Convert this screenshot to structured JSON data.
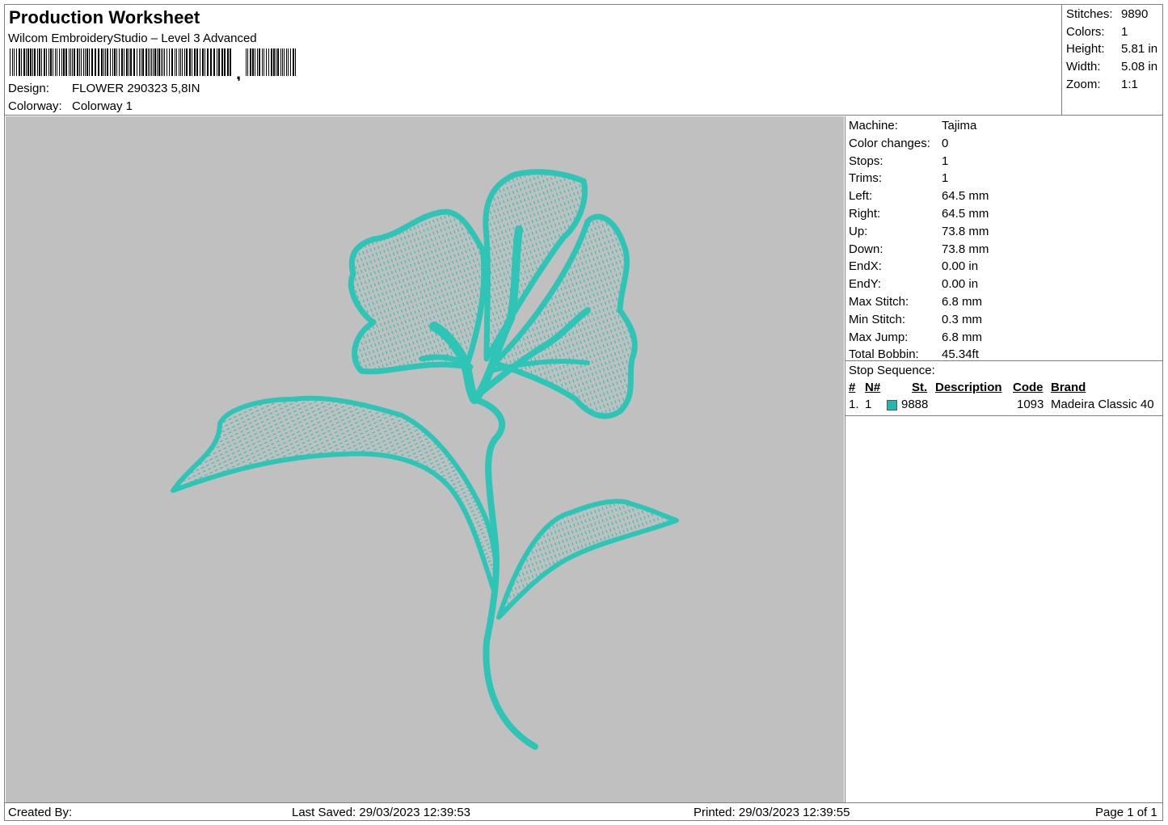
{
  "header": {
    "title": "Production Worksheet",
    "subtitle": "Wilcom EmbroideryStudio – Level 3 Advanced",
    "barcode_label": "barcode",
    "design_label": "Design:",
    "design_value": "FLOWER 290323 5,8IN",
    "colorway_label": "Colorway:",
    "colorway_value": "Colorway 1"
  },
  "summary": {
    "stitches_label": "Stitches:",
    "stitches_value": "9890",
    "colors_label": "Colors:",
    "colors_value": "1",
    "height_label": "Height:",
    "height_value": "5.81 in",
    "width_label": "Width:",
    "width_value": "5.08 in",
    "zoom_label": "Zoom:",
    "zoom_value": "1:1"
  },
  "machine": {
    "rows": [
      {
        "label": "Machine:",
        "value": "Tajima"
      },
      {
        "label": "Color changes:",
        "value": "0"
      },
      {
        "label": "Stops:",
        "value": "1"
      },
      {
        "label": "Trims:",
        "value": "1"
      },
      {
        "label": "Left:",
        "value": "64.5 mm"
      },
      {
        "label": "Right:",
        "value": "64.5 mm"
      },
      {
        "label": "Up:",
        "value": "73.8 mm"
      },
      {
        "label": "Down:",
        "value": "73.8 mm"
      },
      {
        "label": "EndX:",
        "value": "0.00 in"
      },
      {
        "label": "EndY:",
        "value": "0.00 in"
      },
      {
        "label": "Max Stitch:",
        "value": "6.8 mm"
      },
      {
        "label": "Min Stitch:",
        "value": "0.3 mm"
      },
      {
        "label": "Max Jump:",
        "value": "6.8 mm"
      },
      {
        "label": "Total Bobbin:",
        "value": "45.34ft"
      }
    ]
  },
  "stop_sequence": {
    "title": "Stop Sequence:",
    "columns": {
      "num": "#",
      "n": "N#",
      "st": "St.",
      "description": "Description",
      "code": "Code",
      "brand": "Brand"
    },
    "rows": [
      {
        "num": "1.",
        "n": "1",
        "st": "9888",
        "description": "",
        "code": "1093",
        "brand": "Madeira Classic 40",
        "color": "#22b8b0"
      }
    ]
  },
  "design": {
    "thread_color": "#2ec4b6",
    "thread_dark": "#1a9f93",
    "background": "#c0c0c0"
  },
  "footer": {
    "created_by": "Created By:",
    "last_saved": "Last Saved: 29/03/2023 12:39:53",
    "printed": "Printed: 29/03/2023 12:39:55",
    "page": "Page 1 of 1"
  }
}
